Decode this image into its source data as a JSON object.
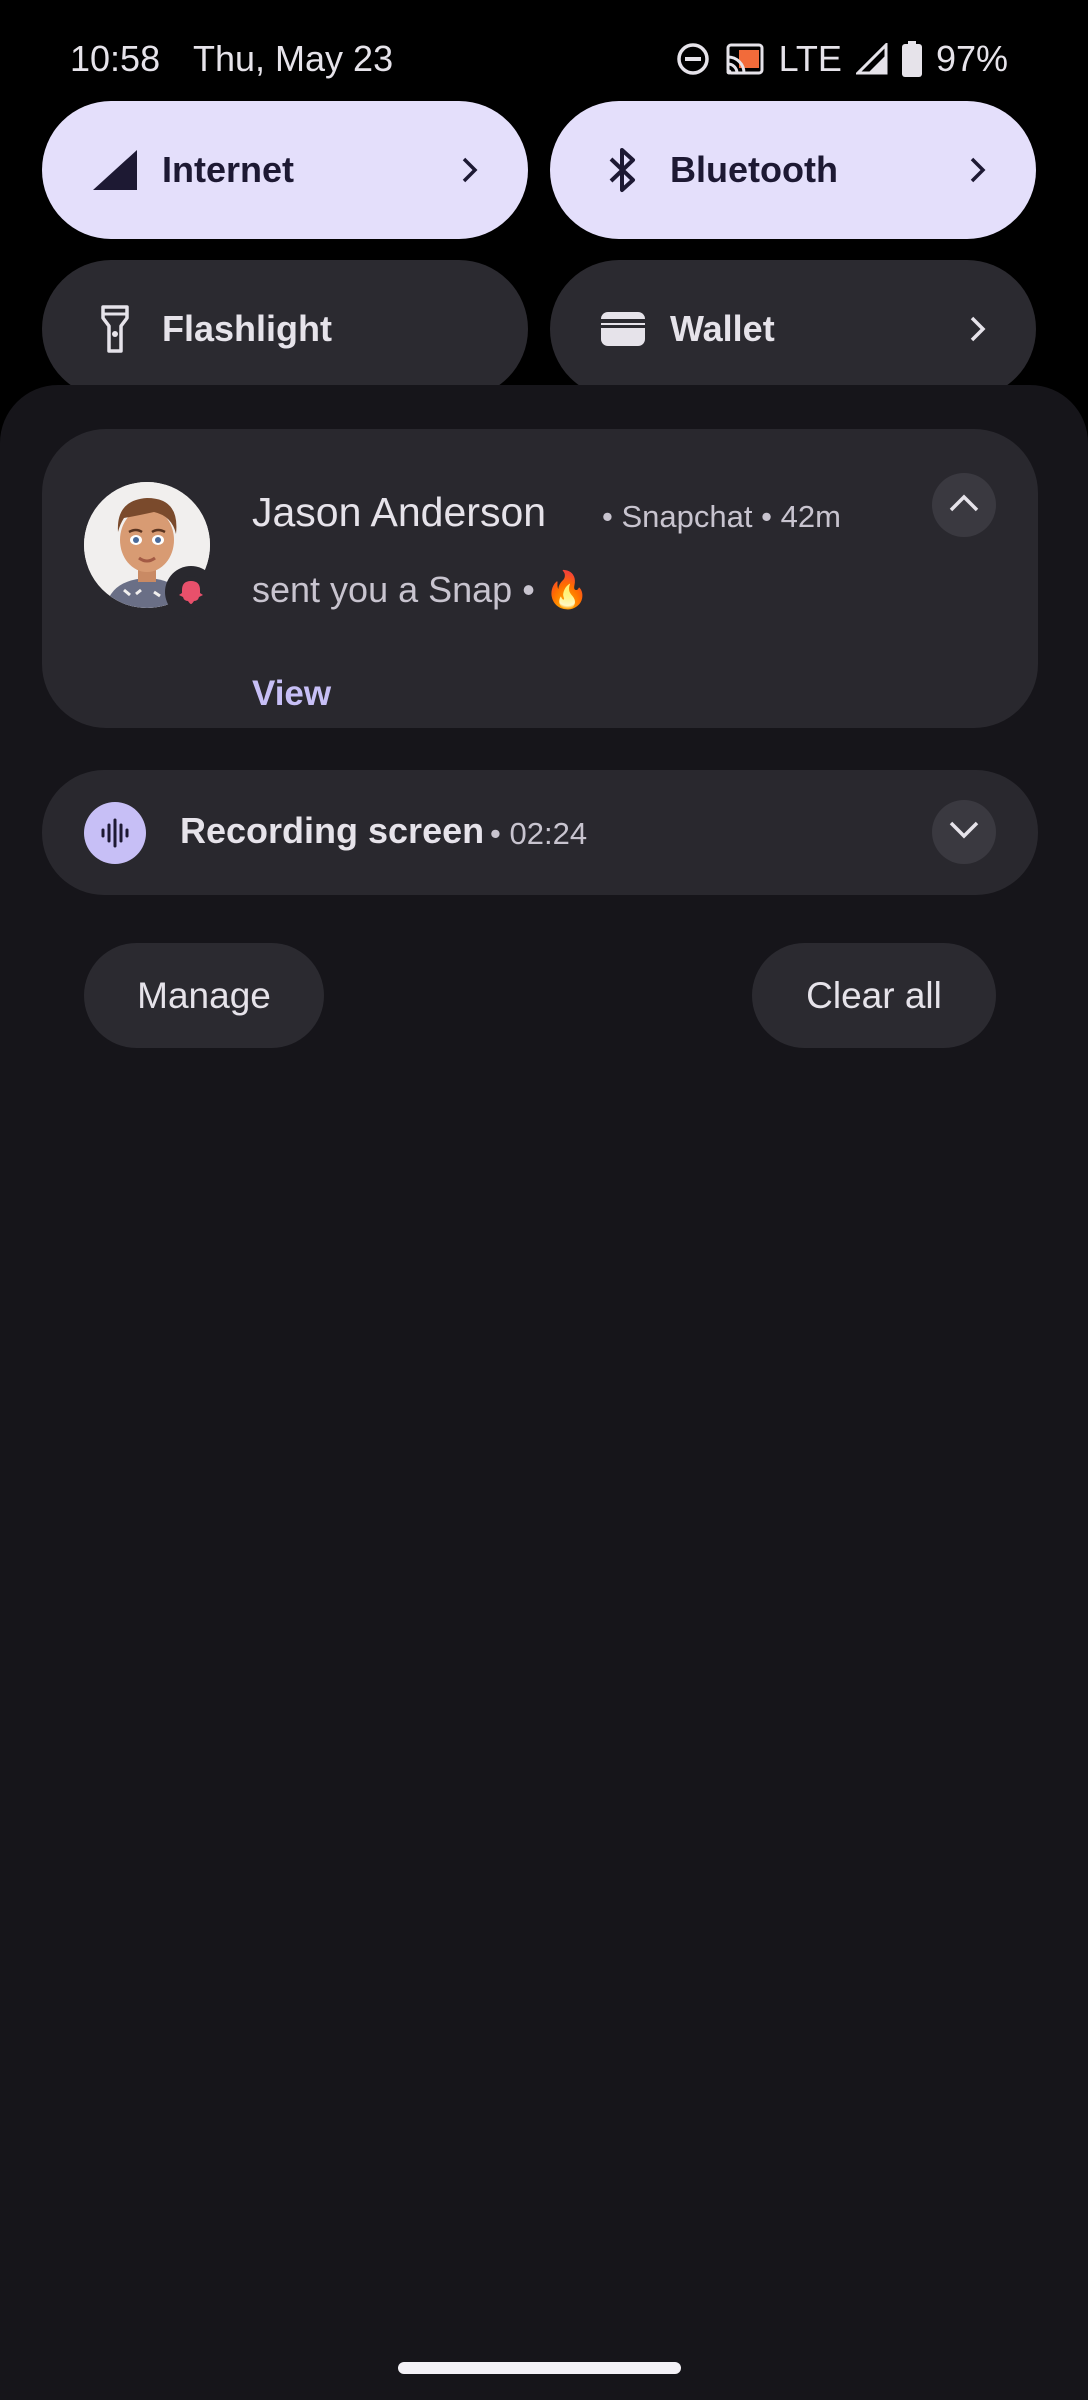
{
  "status_bar": {
    "time": "10:58",
    "date": "Thu, May 23",
    "network_type": "LTE",
    "battery": "97%",
    "icons": [
      "do-not-disturb-icon",
      "cast-icon",
      "signal-icon",
      "battery-icon"
    ]
  },
  "quick_settings": {
    "tiles": [
      {
        "label": "Internet",
        "icon": "signal-icon",
        "state": "on",
        "has_chevron": true
      },
      {
        "label": "Bluetooth",
        "icon": "bluetooth-icon",
        "state": "on",
        "has_chevron": true
      },
      {
        "label": "Flashlight",
        "icon": "flashlight-icon",
        "state": "off",
        "has_chevron": false
      },
      {
        "label": "Wallet",
        "icon": "wallet-icon",
        "state": "off",
        "has_chevron": true
      }
    ]
  },
  "notifications": [
    {
      "sender": "Jason Anderson",
      "app": "Snapchat",
      "time": "42m",
      "separator": "•",
      "message": "sent you a Snap • 🔥",
      "action": "View",
      "expanded": true
    },
    {
      "title": "Recording screen",
      "elapsed": "02:24",
      "separator": "•",
      "expanded": false
    }
  ],
  "footer": {
    "manage_label": "Manage",
    "clear_all_label": "Clear all"
  },
  "colors": {
    "accent": "#c7bff6",
    "tile_active": "#e4dffb",
    "tile_inactive": "#2b2a30",
    "shade_bg": "#16151a",
    "card_bg": "#29282e",
    "snapchat_badge": "#e8506b"
  }
}
